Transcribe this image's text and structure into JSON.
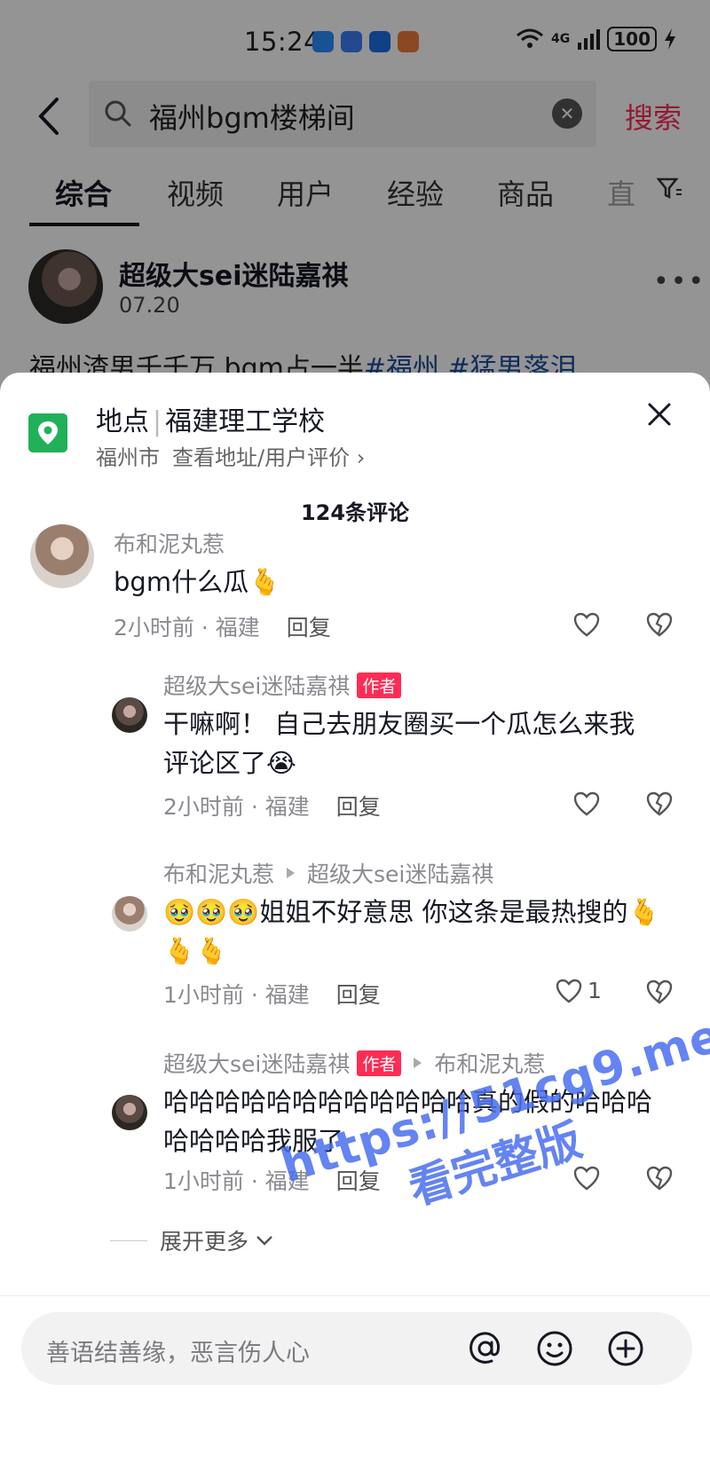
{
  "status_bar": {
    "time": "15:24",
    "network": "4G",
    "battery": "100"
  },
  "search": {
    "query": "福州bgm楼梯间",
    "button_label": "搜索"
  },
  "tabs": [
    {
      "label": "综合",
      "active": true
    },
    {
      "label": "视频"
    },
    {
      "label": "用户"
    },
    {
      "label": "经验"
    },
    {
      "label": "商品"
    },
    {
      "label": "直"
    }
  ],
  "post": {
    "author": "超级大sei迷陆嘉祺",
    "date": "07.20",
    "desc_prefix": "福州渣男千千万 bgm占一半",
    "desc_tags": "#福州 #猛男落泪"
  },
  "location": {
    "label": "地点",
    "name": "福建理工学校",
    "city": "福州市",
    "link": "查看地址/用户评价 ›"
  },
  "comments_count": "124条评论",
  "comments": [
    {
      "user": "布和泥丸惹",
      "text": "bgm什么瓜🫰",
      "time": "2小时前 · 福建",
      "reply": "回复"
    },
    {
      "user": "超级大sei迷陆嘉祺",
      "badge": "作者",
      "text": "干嘛啊！ 自己去朋友圈买一个瓜怎么来我评论区了😭",
      "time": "2小时前 · 福建",
      "reply": "回复"
    },
    {
      "user": "布和泥丸惹",
      "reply_to": "超级大sei迷陆嘉祺",
      "text": "🥹🥹🥹姐姐不好意思 你这条是最热搜的🫰🫰🫰",
      "time": "1小时前 · 福建",
      "reply": "回复",
      "likes": "1"
    },
    {
      "user": "超级大sei迷陆嘉祺",
      "badge": "作者",
      "reply_to": "布和泥丸惹",
      "text": "哈哈哈哈哈哈哈哈哈哈哈哈真的假的哈哈哈哈哈哈哈我服了",
      "time": "1小时前 · 福建",
      "reply": "回复"
    }
  ],
  "expand_more": "展开更多",
  "input": {
    "placeholder": "善语结善缘，恶言伤人心"
  },
  "watermark": {
    "line1": "https://51cg9.me",
    "line2": "看完整版"
  },
  "colors": {
    "accent": "#fe2c55",
    "location_green": "#21b05a",
    "hashtag": "#1a4f9c",
    "watermark": "#4a6ff0"
  }
}
